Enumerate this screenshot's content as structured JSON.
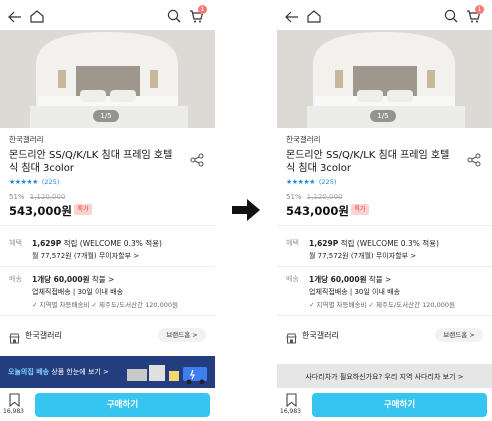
{
  "screens": [
    {
      "cart_count": "1",
      "photo_pager": "1/5",
      "seller": "한국갤러리",
      "title": "몬드리안 SS/Q/K/LK 침대 프레임 호텔식 침대 3color",
      "stars": "★★★★★",
      "review_count": "(225)",
      "discount": "51%",
      "original_price": "1,120,000",
      "price": "543,000원",
      "special_badge": "특가",
      "benefit_label": "혜택",
      "points_value": "1,629P",
      "points_text": " 적립 (WELCOME 0.3% 적용)",
      "installment": "월 77,572원 (7개월) 무이자할부 >",
      "shipping_label": "배송",
      "shipping_fee": "1개당 60,000원",
      "shipping_extra": " 착불 >",
      "shipping_direct": "업체직접배송 | 30일 이내 배송",
      "shipping_note": "✓ 지역별 차등배송비  ✓ 제주도/도서산간 120,000원",
      "store_name": "한국갤러리",
      "brand_home": "브랜드홈 >",
      "banner_highlight": "오늘의집 배송",
      "banner_text": " 상품 한눈에 보기 >",
      "bookmark_count": "16,983",
      "buy_label": "구매하기"
    },
    {
      "cart_count": "1",
      "photo_pager": "1/5",
      "seller": "한국갤러리",
      "title": "몬드리안 SS/Q/K/LK 침대 프레임 호텔식 침대 3color",
      "stars": "★★★★★",
      "review_count": "(225)",
      "discount": "51%",
      "original_price": "1,120,000",
      "price": "543,000원",
      "special_badge": "특가",
      "benefit_label": "혜택",
      "points_value": "1,629P",
      "points_text": " 적립 (WELCOME 0.3% 적용)",
      "installment": "월 77,572원 (7개월) 무이자할부 >",
      "shipping_label": "배송",
      "shipping_fee": "1개당 60,000원",
      "shipping_extra": " 착불 >",
      "shipping_direct": "업체직접배송 | 30일 이내 배송",
      "shipping_note": "✓ 지역별 차등배송비  ✓ 제주도/도서산간 120,000원",
      "store_name": "한국갤러리",
      "brand_home": "브랜드홈 >",
      "banner_text": "사다리차가 필요하신가요? 우리 지역 사다리차 보기 >",
      "bookmark_count": "16,983",
      "buy_label": "구매하기"
    }
  ],
  "colors": {
    "accent": "#35c5f0",
    "star": "#1e88e5",
    "banner_left": "#233e7e",
    "banner_right": "#e6e6e6",
    "badge": "#e53935"
  },
  "icons": [
    "back-arrow-icon",
    "home-icon",
    "search-icon",
    "cart-icon",
    "share-icon",
    "store-icon",
    "bookmark-icon",
    "transition-arrow-icon"
  ]
}
